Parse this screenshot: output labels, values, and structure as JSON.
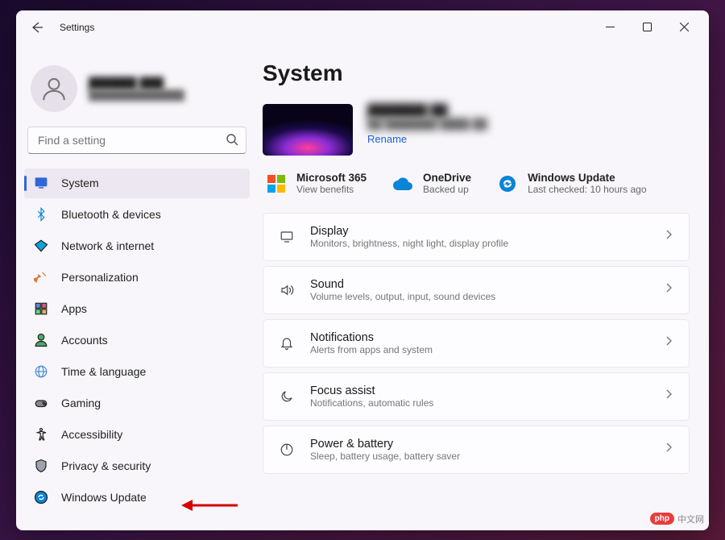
{
  "window": {
    "title": "Settings"
  },
  "profile": {
    "name": "██████ ███",
    "email": "██████████████"
  },
  "search": {
    "placeholder": "Find a setting"
  },
  "nav": [
    {
      "id": "system",
      "label": "System",
      "icon": "system",
      "active": true
    },
    {
      "id": "bluetooth",
      "label": "Bluetooth & devices",
      "icon": "bluetooth",
      "active": false
    },
    {
      "id": "network",
      "label": "Network & internet",
      "icon": "wifi",
      "active": false
    },
    {
      "id": "personalization",
      "label": "Personalization",
      "icon": "paint",
      "active": false
    },
    {
      "id": "apps",
      "label": "Apps",
      "icon": "apps",
      "active": false
    },
    {
      "id": "accounts",
      "label": "Accounts",
      "icon": "person",
      "active": false
    },
    {
      "id": "time",
      "label": "Time & language",
      "icon": "globe",
      "active": false
    },
    {
      "id": "gaming",
      "label": "Gaming",
      "icon": "game",
      "active": false
    },
    {
      "id": "accessibility",
      "label": "Accessibility",
      "icon": "access",
      "active": false
    },
    {
      "id": "privacy",
      "label": "Privacy & security",
      "icon": "shield",
      "active": false
    },
    {
      "id": "update",
      "label": "Windows Update",
      "icon": "update",
      "active": false
    }
  ],
  "main": {
    "heading": "System",
    "device": {
      "name": "███████ ██",
      "model": "██ ███████ ████ ██",
      "rename": "Rename"
    },
    "quick": [
      {
        "id": "ms365",
        "title": "Microsoft 365",
        "sub": "View benefits"
      },
      {
        "id": "onedrive",
        "title": "OneDrive",
        "sub": "Backed up"
      },
      {
        "id": "winupdate",
        "title": "Windows Update",
        "sub": "Last checked: 10 hours ago"
      }
    ],
    "cards": [
      {
        "id": "display",
        "title": "Display",
        "sub": "Monitors, brightness, night light, display profile",
        "icon": "display"
      },
      {
        "id": "sound",
        "title": "Sound",
        "sub": "Volume levels, output, input, sound devices",
        "icon": "sound"
      },
      {
        "id": "notifications",
        "title": "Notifications",
        "sub": "Alerts from apps and system",
        "icon": "bell"
      },
      {
        "id": "focus",
        "title": "Focus assist",
        "sub": "Notifications, automatic rules",
        "icon": "moon"
      },
      {
        "id": "power",
        "title": "Power & battery",
        "sub": "Sleep, battery usage, battery saver",
        "icon": "power"
      }
    ]
  },
  "watermark": {
    "badge": "php",
    "text": "中文网"
  }
}
